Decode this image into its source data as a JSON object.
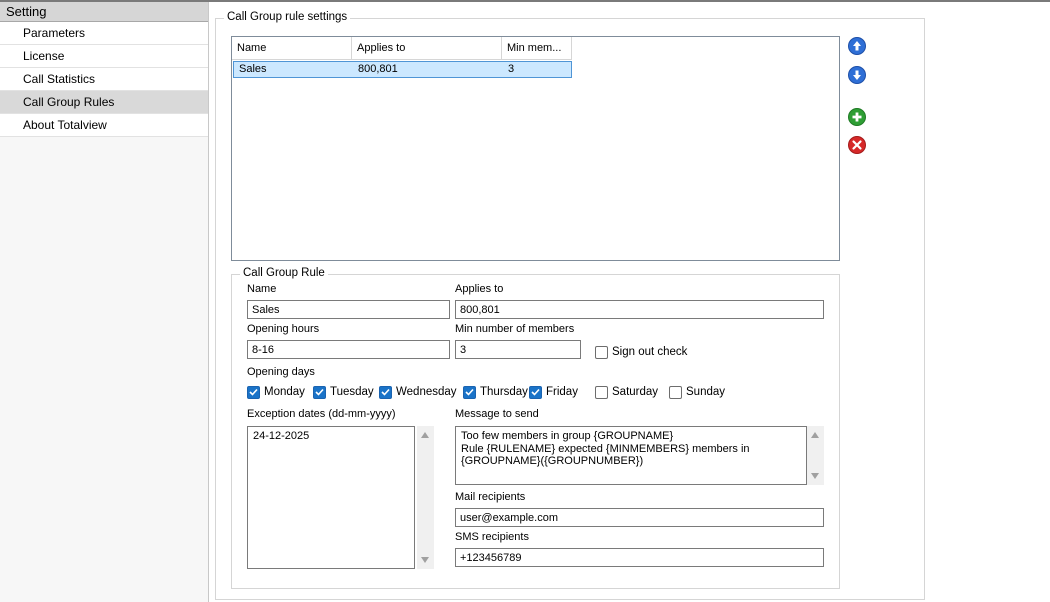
{
  "sidebar": {
    "header": "Setting",
    "items": [
      {
        "label": "Parameters"
      },
      {
        "label": "License"
      },
      {
        "label": "Call Statistics"
      },
      {
        "label": "Call Group Rules"
      },
      {
        "label": "About Totalview"
      }
    ],
    "active_index": 3
  },
  "settings": {
    "legend": "Call Group rule settings",
    "table": {
      "columns": [
        "Name",
        "Applies to",
        "Min mem..."
      ],
      "rows": [
        {
          "name": "Sales",
          "applies_to": "800,801",
          "min_members": "3"
        }
      ]
    },
    "buttons": {
      "move_up": "move-up-icon",
      "move_down": "move-down-icon",
      "add": "add-icon",
      "delete": "delete-icon"
    }
  },
  "rule": {
    "legend": "Call Group Rule",
    "name_label": "Name",
    "name_value": "Sales",
    "applies_label": "Applies to",
    "applies_value": "800,801",
    "opening_hours_label": "Opening hours",
    "opening_hours_value": "8-16",
    "min_members_label": "Min number of members",
    "min_members_value": "3",
    "sign_out_label": "Sign out check",
    "opening_days_label": "Opening days",
    "days": [
      {
        "label": "Monday",
        "checked": true
      },
      {
        "label": "Tuesday",
        "checked": true
      },
      {
        "label": "Wednesday",
        "checked": true
      },
      {
        "label": "Thursday",
        "checked": true
      },
      {
        "label": "Friday",
        "checked": true
      },
      {
        "label": "Saturday",
        "checked": false
      },
      {
        "label": "Sunday",
        "checked": false
      }
    ],
    "exception_label": "Exception dates (dd-mm-yyyy)",
    "exception_value": "24-12-2025",
    "message_label": "Message to send",
    "message_lines": [
      "Too few members in group {GROUPNAME}",
      "Rule {RULENAME} expected {MINMEMBERS} members in",
      "{GROUPNAME}({GROUPNUMBER})"
    ],
    "mail_label": "Mail recipients",
    "mail_value": "user@example.com",
    "sms_label": "SMS recipients",
    "sms_value": "+123456789"
  },
  "colors": {
    "selection": "#cce8ff",
    "checkbox_checked": "#1a73c8",
    "up_down_button": "#2f6fd6",
    "add_button": "#2e9e34",
    "delete_button": "#d62828"
  }
}
